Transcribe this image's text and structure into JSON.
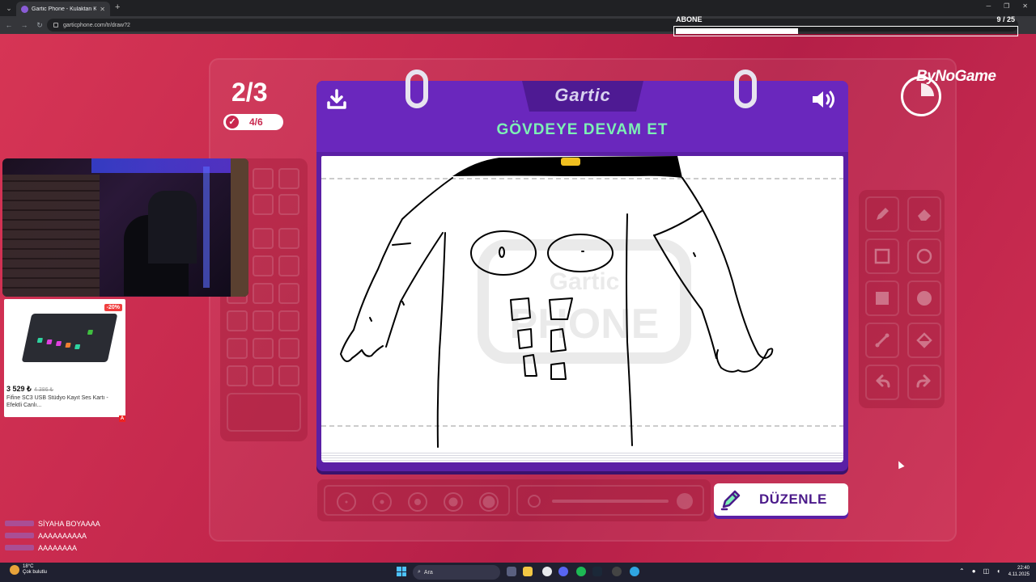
{
  "browser": {
    "tab_title": "Gartic Phone - Kulaktan Kulağa",
    "url": "garticphone.com/tr/draw?2"
  },
  "overlay": {
    "label": "ABONE",
    "count": "9 / 25",
    "progress": 0.36
  },
  "game": {
    "round": "2/3",
    "progress_count": "4/6",
    "logo": "Gartic",
    "prompt": "GÖVDEYE DEVAM ET",
    "edit_label": "DÜZENLE"
  },
  "brand": {
    "name": "ByNoGame"
  },
  "ad": {
    "discount": "-20%",
    "price": "3 529 ₺",
    "old_price": "4 386 ₺",
    "title": "Fifine SC3 USB Stüdyo Kayıt Ses Kartı - Efektli Canlı..."
  },
  "chat": {
    "messages": [
      "SİYAHA BOYAAAA",
      "AAAAAAAAAA",
      "AAAAAAAA"
    ]
  },
  "taskbar": {
    "weather_temp": "18°C",
    "weather_desc": "Çok bulutlu",
    "search_placeholder": "Ara",
    "time": "22:40",
    "date": "4.11.2025"
  },
  "tools": [
    "pencil-icon",
    "eraser-icon",
    "rectangle-outline-icon",
    "ellipse-outline-icon",
    "rectangle-filled-icon",
    "ellipse-filled-icon",
    "line-icon",
    "fill-bucket-icon",
    "undo-icon",
    "redo-icon"
  ],
  "colors": {
    "background": "#c8284e",
    "panel": "#5b1fa5",
    "prompt": "#7df0b5"
  }
}
